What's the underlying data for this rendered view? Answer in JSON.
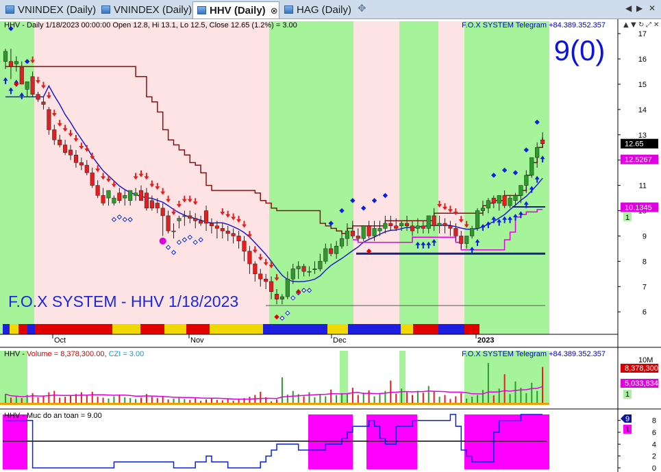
{
  "tabs": [
    {
      "label": "VNINDEX (Daily)",
      "active": false
    },
    {
      "label": "VNINDEX (Daily)",
      "active": false
    },
    {
      "label": "HHV (Daily)",
      "active": true
    },
    {
      "label": "HAG (Daily)",
      "active": false
    }
  ],
  "tab_close_symbol": "⊗",
  "tab_new_symbol": "✥",
  "tab_nav": {
    "left": "◀",
    "right": "▶",
    "close": "✕"
  },
  "toolbar_icons": [
    "up-arrow-icon",
    "down-arrow-icon",
    "cycle-icon",
    "expand-icon",
    "close-icon"
  ],
  "main_panel": {
    "header": "HHV - Daily 1/18/2023 00:00:00 Open 12.8, Hi 13.1, Lo 12.5, Close 12.65 (1.2%)  = 3.00",
    "brand": "F.O.X SYSTEM Telegram +84.389.352.357",
    "signal": "9(0)",
    "watermark": "F.O.X SYSTEM - HHV 1/18/2023",
    "yticks": [
      "17",
      "16",
      "15",
      "14",
      "13",
      "12",
      "11",
      "10",
      "9",
      "8",
      "7",
      "6"
    ],
    "price_labels": {
      "close": "12.65",
      "magenta": "12.5267",
      "ma": "10.1345",
      "count": "1"
    }
  },
  "date_labels": [
    "Oct",
    "Nov",
    "Dec",
    "2023"
  ],
  "volume_panel": {
    "header_prefix": "HHV - ",
    "volume_text": "Volume = 8,378,300.00,",
    "czi_text": "CZI = 3.00",
    "brand": "F.O.X SYSTEM Telegram +84.389.352.357",
    "yticks": [
      "10M"
    ],
    "labels": {
      "volume": "8,378,300",
      "czi": "5,033,834",
      "count": "1"
    }
  },
  "safety_panel": {
    "header": "HHV - Muc do an toan = 9.00",
    "yticks": [
      "8",
      "6",
      "4",
      "2",
      "0"
    ],
    "labels": {
      "value": "9",
      "count": "1"
    }
  },
  "colors": {
    "green_zone": "#a6f49a",
    "pink_zone": "#fde3e3",
    "up_candle": "#2e9a2e",
    "down_candle": "#e41e1e",
    "signal_blue": "#0a1ee8",
    "ma_blue": "#1c1ccc",
    "resistance_red": "#8b0f0f",
    "magenta": "#e000e0",
    "safety_fill": "#ff00ff",
    "tab_bg": "#cfdcec"
  },
  "chart_data": [
    {
      "type": "candlestick",
      "title": "HHV - Daily 1/18/2023",
      "ylim": [
        5.6,
        17.3
      ],
      "x": [
        "8/29",
        "8/30",
        "8/31",
        "9/5",
        "9/6",
        "9/7",
        "9/8",
        "9/9",
        "9/12",
        "9/13",
        "9/14",
        "9/15",
        "9/16",
        "9/19",
        "9/20",
        "9/21",
        "9/22",
        "9/23",
        "9/26",
        "9/27",
        "9/28",
        "9/29",
        "9/30",
        "10/3",
        "10/4",
        "10/5",
        "10/6",
        "10/7",
        "10/10",
        "10/11",
        "10/12",
        "10/13",
        "10/14",
        "10/17",
        "10/18",
        "10/19",
        "10/20",
        "10/21",
        "10/24",
        "10/25",
        "10/26",
        "10/27",
        "10/28",
        "10/31",
        "11/1",
        "11/2",
        "11/3",
        "11/4",
        "11/7",
        "11/8",
        "11/9",
        "11/10",
        "11/11",
        "11/14",
        "11/15",
        "11/16",
        "11/17",
        "11/18",
        "11/21",
        "11/22",
        "11/23",
        "11/24",
        "11/25",
        "11/28",
        "11/29",
        "11/30",
        "12/1",
        "12/2",
        "12/5",
        "12/6",
        "12/7",
        "12/8",
        "12/9",
        "12/12",
        "12/13",
        "12/14",
        "12/15",
        "12/16",
        "12/19",
        "12/20",
        "12/21",
        "12/22",
        "12/23",
        "12/26",
        "12/27",
        "12/28",
        "12/29",
        "12/30",
        "1/3",
        "1/4",
        "1/5",
        "1/6",
        "1/9",
        "1/10",
        "1/11",
        "1/12",
        "1/13",
        "1/16",
        "1/17",
        "1/18"
      ],
      "open": [
        15.9,
        15.9,
        15.8,
        15.7,
        14.8,
        15.3,
        14.6,
        14.3,
        14.0,
        13.2,
        12.8,
        12.6,
        12.4,
        12.2,
        11.9,
        11.8,
        11.5,
        11.0,
        10.6,
        10.5,
        10.3,
        10.7,
        10.5,
        10.4,
        10.6,
        10.8,
        10.7,
        10.4,
        10.3,
        10.1,
        9.8,
        9.2,
        9.6,
        9.8,
        9.8,
        9.7,
        9.6,
        10.0,
        9.5,
        9.4,
        9.3,
        9.2,
        9.1,
        9.0,
        8.8,
        8.4,
        7.9,
        7.5,
        7.3,
        7.2,
        6.7,
        6.5,
        6.6,
        7.3,
        7.7,
        7.8,
        7.6,
        7.7,
        7.7,
        8.0,
        8.5,
        8.3,
        8.6,
        8.9,
        9.2,
        9.0,
        8.9,
        9.4,
        9.0,
        9.2,
        9.3,
        9.5,
        9.4,
        9.4,
        9.5,
        9.4,
        9.3,
        9.4,
        9.3,
        9.8,
        9.4,
        9.5,
        9.4,
        9.3,
        9.0,
        8.7,
        9.0,
        9.3,
        10.0,
        10.1,
        10.5,
        10.3,
        10.6,
        10.2,
        10.4,
        10.6,
        11.0,
        11.4,
        12.1,
        12.8
      ],
      "high": [
        16.4,
        16.4,
        16.1,
        15.9,
        15.1,
        15.5,
        14.7,
        14.5,
        14.1,
        13.4,
        13.0,
        12.8,
        12.6,
        12.4,
        12.1,
        12.0,
        11.7,
        11.2,
        10.9,
        10.8,
        10.6,
        10.9,
        10.8,
        10.7,
        10.9,
        11.0,
        10.9,
        10.6,
        10.5,
        10.3,
        10.0,
        9.5,
        9.8,
        10.0,
        10.0,
        9.9,
        9.8,
        10.2,
        9.7,
        9.6,
        9.5,
        9.4,
        9.3,
        9.2,
        9.0,
        8.6,
        8.0,
        7.7,
        7.5,
        7.4,
        6.9,
        6.7,
        7.6,
        7.9,
        8.0,
        7.9,
        7.8,
        8.0,
        8.3,
        8.7,
        8.7,
        8.8,
        9.2,
        9.5,
        9.6,
        9.3,
        9.3,
        9.6,
        9.6,
        9.6,
        9.8,
        9.8,
        9.7,
        9.6,
        9.8,
        9.6,
        9.7,
        9.6,
        9.8,
        10.1,
        9.8,
        9.7,
        9.6,
        9.5,
        9.2,
        9.0,
        9.4,
        10.1,
        10.4,
        10.5,
        10.6,
        10.6,
        10.8,
        10.6,
        10.7,
        11.0,
        11.6,
        12.1,
        12.7,
        13.1
      ],
      "low": [
        15.6,
        15.2,
        15.5,
        15.0,
        14.5,
        14.5,
        14.3,
        14.0,
        13.0,
        12.6,
        12.5,
        12.2,
        12.0,
        11.7,
        11.6,
        11.4,
        10.9,
        10.5,
        10.2,
        10.2,
        10.2,
        10.3,
        10.2,
        10.2,
        10.4,
        10.4,
        10.0,
        10.0,
        9.9,
        9.0,
        9.1,
        8.9,
        9.3,
        9.4,
        9.5,
        9.3,
        9.4,
        9.2,
        9.1,
        8.9,
        8.9,
        8.8,
        8.7,
        8.5,
        8.0,
        7.5,
        7.2,
        7.0,
        6.9,
        6.5,
        6.3,
        6.3,
        6.5,
        7.1,
        7.3,
        7.4,
        7.4,
        7.5,
        7.6,
        7.9,
        8.2,
        8.1,
        8.5,
        8.6,
        8.9,
        8.8,
        8.8,
        8.9,
        8.8,
        9.0,
        9.1,
        9.2,
        9.2,
        9.2,
        9.2,
        9.0,
        9.1,
        9.1,
        9.1,
        9.2,
        9.1,
        9.1,
        9.0,
        8.8,
        8.5,
        8.5,
        8.9,
        9.2,
        9.8,
        9.9,
        10.1,
        10.0,
        10.1,
        10.1,
        10.2,
        10.3,
        10.7,
        11.3,
        11.7,
        12.5
      ],
      "close": [
        16.3,
        15.7,
        15.9,
        15.0,
        15.1,
        14.6,
        14.4,
        14.2,
        13.2,
        12.8,
        12.6,
        12.3,
        12.2,
        11.9,
        11.8,
        11.5,
        11.0,
        10.6,
        10.3,
        10.8,
        10.5,
        10.4,
        10.6,
        10.8,
        10.7,
        10.4,
        10.1,
        10.1,
        10.1,
        9.8,
        9.2,
        9.2,
        9.7,
        9.8,
        9.7,
        9.6,
        9.5,
        9.5,
        9.4,
        9.3,
        9.2,
        9.1,
        9.0,
        8.8,
        8.4,
        7.9,
        7.5,
        7.3,
        7.2,
        6.8,
        6.5,
        6.6,
        7.3,
        7.7,
        7.8,
        7.6,
        7.6,
        7.7,
        8.0,
        8.5,
        8.3,
        8.6,
        8.9,
        9.2,
        9.0,
        8.9,
        9.4,
        9.0,
        9.3,
        9.3,
        9.5,
        9.4,
        9.3,
        9.5,
        9.4,
        9.2,
        9.4,
        9.3,
        9.8,
        9.4,
        9.5,
        9.4,
        9.3,
        9.0,
        8.7,
        9.0,
        9.3,
        10.0,
        10.1,
        10.4,
        10.3,
        10.6,
        10.2,
        10.5,
        10.6,
        11.0,
        11.4,
        12.1,
        12.5,
        12.65
      ]
    },
    {
      "type": "bar",
      "title": "HHV - Volume = 8,378,300.00, CZI = 3.00",
      "ylim": [
        0,
        12000000
      ],
      "values": [
        2.4,
        1.6,
        1.8,
        1.5,
        2.2,
        2.6,
        1.7,
        1.9,
        2.8,
        3.1,
        1.6,
        1.8,
        2.1,
        2.4,
        2.8,
        2.2,
        2.9,
        1.8,
        1.6,
        1.4,
        1.9,
        2.2,
        1.7,
        1.5,
        1.3,
        1.6,
        2.4,
        1.8,
        1.5,
        1.9,
        1.2,
        1.4,
        1.6,
        1.3,
        1.1,
        1.5,
        0.9,
        1.2,
        1.6,
        1.1,
        1.0,
        1.3,
        0.9,
        1.2,
        1.5,
        1.8,
        2.2,
        2.9,
        1.7,
        0.8,
        1.2,
        6.1,
        2.3,
        3.1,
        2.4,
        1.9,
        2.8,
        1.7,
        2.4,
        1.9,
        3.4,
        2.2,
        2.6,
        2.5,
        3.8,
        2.2,
        2.7,
        3.2,
        1.9,
        2.6,
        3.1,
        5.4,
        2.5,
        3.6,
        2.8,
        2.2,
        3.1,
        2.7,
        4.2,
        2.9,
        1.8,
        2.2,
        1.3,
        1.9,
        2.6,
        1.4,
        1.8,
        2.2,
        3.3,
        9.3,
        2.1,
        3.6,
        6.8,
        2.4,
        5.2,
        3.8,
        2.6,
        4.9,
        3.1,
        8.4
      ]
    },
    {
      "type": "line",
      "title": "HHV - Muc do an toan = 9.00",
      "ylim": [
        0,
        9
      ],
      "values": [
        8,
        8,
        8,
        8,
        8,
        0,
        0,
        0,
        0,
        0,
        0,
        0,
        0,
        0,
        0,
        0,
        0,
        0,
        0,
        0,
        1,
        1,
        1,
        1,
        1,
        1,
        1,
        1,
        1,
        1,
        1,
        0,
        0,
        0,
        0,
        1,
        1,
        2,
        1,
        1,
        1,
        0,
        0,
        0,
        0,
        0,
        0,
        1,
        2,
        3,
        4,
        4,
        4,
        4,
        3,
        3,
        3,
        3,
        3,
        4,
        4,
        4,
        5,
        6,
        7,
        7,
        7,
        8,
        7,
        5,
        4,
        4,
        7,
        7,
        7,
        8,
        8,
        8,
        8,
        8,
        8,
        8,
        9,
        7,
        3,
        2,
        1,
        1,
        1,
        1,
        6,
        8,
        8,
        8,
        8,
        9,
        9,
        9,
        9,
        9,
        9,
        9,
        9,
        9
      ],
      "fill_ranges": [
        "11/28-12/6",
        "12/13-12/21",
        "1/3-1/18"
      ]
    }
  ]
}
